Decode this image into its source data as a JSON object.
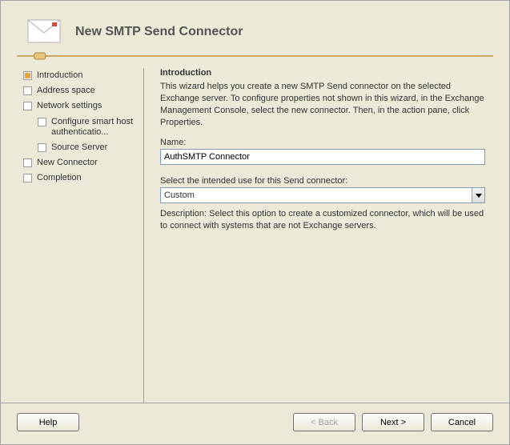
{
  "title": "New SMTP Send Connector",
  "sidebar": {
    "items": [
      {
        "label": "Introduction",
        "active": true,
        "indent": false
      },
      {
        "label": "Address space",
        "active": false,
        "indent": false
      },
      {
        "label": "Network settings",
        "active": false,
        "indent": false
      },
      {
        "label": "Configure smart host authenticatio...",
        "active": false,
        "indent": true
      },
      {
        "label": "Source Server",
        "active": false,
        "indent": true
      },
      {
        "label": "New Connector",
        "active": false,
        "indent": false
      },
      {
        "label": "Completion",
        "active": false,
        "indent": false
      }
    ]
  },
  "content": {
    "heading": "Introduction",
    "intro": "This wizard helps you create a new SMTP Send connector on the selected Exchange server. To configure properties not shown in this wizard, in the Exchange Management Console, select the new connector. Then, in the action pane, click Properties.",
    "name_label": "Name:",
    "name_value": "AuthSMTP Connector",
    "use_label": "Select the intended use for this Send connector:",
    "use_value": "Custom",
    "description": "Description: Select this option to create a customized connector, which will be used to connect with systems that are not Exchange servers."
  },
  "footer": {
    "help": "Help",
    "back": "< Back",
    "next": "Next >",
    "cancel": "Cancel"
  }
}
